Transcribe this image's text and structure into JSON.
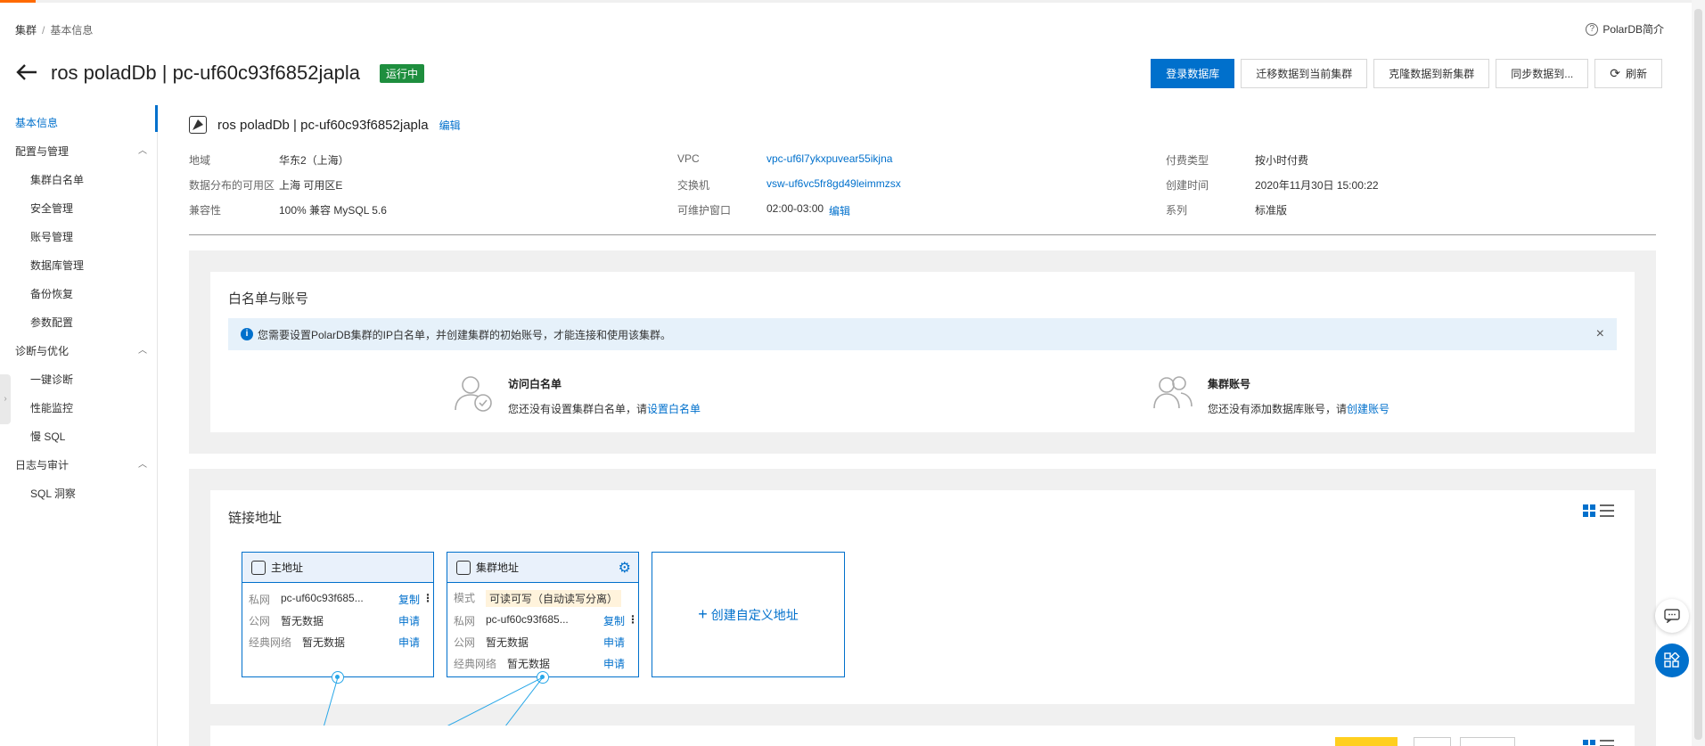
{
  "breadcrumb": {
    "root": "集群",
    "sep": "/",
    "current": "基本信息"
  },
  "help_link": "PolarDB简介",
  "header": {
    "title": "ros poladDb | pc-uf60c93f6852japla",
    "status": "运行中",
    "status_color": "#1e8e3e"
  },
  "toolbar": {
    "login_db": "登录数据库",
    "migrate": "迁移数据到当前集群",
    "clone": "克隆数据到新集群",
    "sync": "同步数据到...",
    "refresh": "刷新"
  },
  "sidebar": {
    "items": [
      {
        "label": "基本信息",
        "active": true
      },
      {
        "label": "配置与管理",
        "group": true
      },
      {
        "label": "集群白名单"
      },
      {
        "label": "安全管理"
      },
      {
        "label": "账号管理"
      },
      {
        "label": "数据库管理"
      },
      {
        "label": "备份恢复"
      },
      {
        "label": "参数配置"
      },
      {
        "label": "诊断与优化",
        "group": true
      },
      {
        "label": "一键诊断"
      },
      {
        "label": "性能监控"
      },
      {
        "label": "慢 SQL"
      },
      {
        "label": "日志与审计",
        "group": true
      },
      {
        "label": "SQL 洞察"
      }
    ]
  },
  "info": {
    "title": "ros poladDb | pc-uf60c93f6852japla",
    "edit": "编辑",
    "region_label": "地域",
    "region": "华东2（上海）",
    "zone_label": "数据分布的可用区",
    "zone": "上海 可用区E",
    "compat_label": "兼容性",
    "compat": "100% 兼容 MySQL 5.6",
    "vpc_label": "VPC",
    "vpc": "vpc-uf6l7ykxpuvear55ikjna",
    "vsw_label": "交换机",
    "vsw": "vsw-uf6vc5fr8gd49leimmzsx",
    "maint_label": "可维护窗口",
    "maint": "02:00-03:00",
    "maint_edit": "编辑",
    "billing_label": "付费类型",
    "billing": "按小时付费",
    "created_label": "创建时间",
    "created": "2020年11月30日 15:00:22",
    "series_label": "系列",
    "series": "标准版"
  },
  "whitelist_section": {
    "title": "白名单与账号",
    "notice": "您需要设置PolarDB集群的IP白名单，并创建集群的初始账号，才能连接和使用该集群。",
    "whitelist_title": "访问白名单",
    "whitelist_desc": "您还没有设置集群白名单，请",
    "whitelist_link": "设置白名单",
    "account_title": "集群账号",
    "account_desc": "您还没有添加数据库账号，请",
    "account_link": "创建账号"
  },
  "endpoint_section": {
    "title": "链接地址",
    "primary": {
      "title": "主地址",
      "private_label": "私网",
      "private": "pc-uf60c93f685...",
      "copy": "复制",
      "public_label": "公网",
      "public": "暂无数据",
      "public_apply": "申请",
      "classic_label": "经典网络",
      "classic": "暂无数据",
      "classic_apply": "申请"
    },
    "cluster": {
      "title": "集群地址",
      "mode_label": "模式",
      "mode": "可读可写（自动读写分离）",
      "private_label": "私网",
      "private": "pc-uf60c93f685...",
      "copy": "复制",
      "public_label": "公网",
      "public": "暂无数据",
      "public_apply": "申请",
      "classic_label": "经典网络",
      "classic": "暂无数据",
      "classic_apply": "申请"
    },
    "custom": "创建自定义地址"
  },
  "colors": {
    "accent": "#0070cc",
    "brand_orange": "#ff6a00",
    "connector": "#28a7e8"
  },
  "icons": [
    "back-arrow-icon",
    "question-icon",
    "refresh-icon",
    "info-icon",
    "close-icon",
    "user-check-icon",
    "users-icon",
    "gear-icon",
    "grid-view-icon",
    "list-view-icon",
    "chat-icon",
    "apps-icon"
  ]
}
